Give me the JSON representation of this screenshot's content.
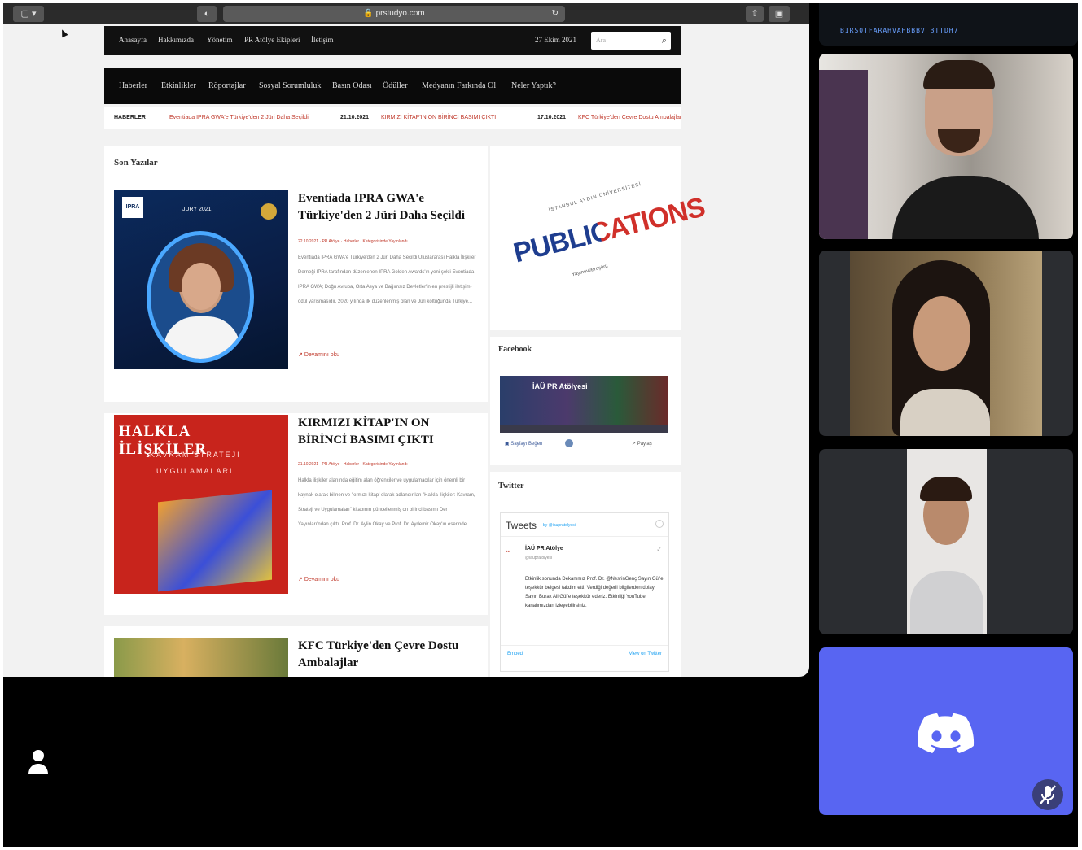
{
  "browser": {
    "url": "prstudyo.com"
  },
  "site": {
    "topnav": [
      "Anasayfa",
      "Hakkımızda",
      "Yönetim",
      "PR Atölye Ekipleri",
      "İletişim"
    ],
    "date": "27 Ekim 2021",
    "search_placeholder": "Ara",
    "mainnav": [
      "Haberler",
      "Etkinlikler",
      "Röportajlar",
      "Sosyal Sorumluluk",
      "Basın Odası",
      "Ödüller",
      "Medyanın Farkında Ol",
      "Neler Yaptık?"
    ],
    "ticker": {
      "label": "HABERLER",
      "items": [
        {
          "date": "",
          "text": "Eventiada IPRA GWA'e Türkiye'den 2 Jüri Daha Seçildi"
        },
        {
          "date": "21.10.2021",
          "text": "KIRMIZI KİTAP'IN ON BİRİNCİ BASIMI ÇIKTI"
        },
        {
          "date": "17.10.2021",
          "text": "KFC Türkiye'den Çevre Dostu Ambalajlar"
        }
      ]
    },
    "section_title": "Son Yazılar",
    "articles": [
      {
        "title": "Eventiada IPRA GWA'e Türkiye'den 2 Jüri Daha Seçildi",
        "meta": "22.10.2021 · PR Atölye · Haberler · Kategorisinde Yayınlandı",
        "body": "Eventiada IPRA GWA'e Türkiye'den 2 Jüri Daha Seçildi Uluslararası Halkla İlişkiler Derneği IPRA tarafından düzenlenen IPRA Golden Awards'ın yeni şekli Eventiada IPRA GWA; Doğu Avrupa, Orta Asya ve Bağımsız Devletler'in en prestijli iletişim-ödül yarışmasıdır. 2020 yılında ilk düzenlenmiş olan ve Jüri koltuğunda Türkiye...",
        "more": "Devamını oku",
        "thumb_caption": "JURY 2021",
        "thumb_logo": "IPRA"
      },
      {
        "title": "KIRMIZI KİTAP'IN ON BİRİNCİ BASIMI ÇIKTI",
        "meta": "21.10.2021 · PR Atölye · Haberler · Kategorisinde Yayınlandı",
        "body": "Halkla ilişkiler alanında eğitim alan öğrenciler ve uygulamacılar için önemli bir kaynak olarak bilinen ve 'kırmızı kitap' olarak adlandırılan \"Halkla İlişkiler: Kavram, Strateji ve Uygulamaları\" kitabının güncellenmiş on birinci basımı Der Yayınları'ndan çıktı. Prof. Dr. Aylin Okay ve Prof. Dr. Aydemir Okay'ın eserinde...",
        "more": "Devamını oku",
        "thumb_title": "HALKLA İLİŞKİLER",
        "thumb_sub1": "KAVRAM   STRATEJİ",
        "thumb_sub2": "UYGULAMALARI"
      },
      {
        "title": "KFC Türkiye'den Çevre Dostu Ambalajlar"
      }
    ],
    "sidebar": {
      "publications": {
        "top": "İSTANBUL AYDIN ÜNİVERSİTESİ",
        "word": "PUBLICATIONS",
        "bottom": "Yayınevi/Broşürü"
      },
      "facebook_title": "Facebook",
      "facebook_page": "İAÜ PR Atölyesi",
      "facebook_like": "Sayfayı Beğen",
      "facebook_share": "Paylaş",
      "twitter_title": "Twitter",
      "tweets_header": "Tweets",
      "tweets_by": "by @iaupratolyesi",
      "tweet_user": "İAÜ PR Atölye",
      "tweet_handle": "@iaupratolyesi",
      "tweet_text": "Etkinlik sonunda Dekanımız Prof. Dr. @NesrinGenç Sayın Gül'e teşekkür belgesi takdim etti. Verdiği değerli bilgilerden dolayı Sayın Burak Ali Gül'e teşekkür ederiz. Etkinliği YouTube kanalımızdan izleyebilirsiniz.",
      "embed": "Embed",
      "view_on": "View on Twitter"
    }
  },
  "call": {
    "strip_text": "BIRS0TFARAHVAHBBBV BTTDH7",
    "tiles": [
      "participant-1",
      "participant-2",
      "participant-3"
    ],
    "discord_color": "#5865f2"
  }
}
